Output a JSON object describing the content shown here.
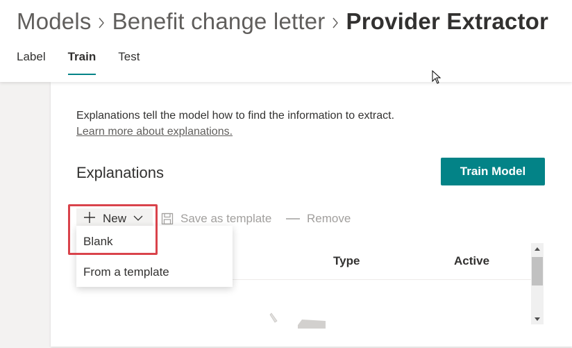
{
  "breadcrumb": {
    "items": [
      "Models",
      "Benefit change letter",
      "Provider Extractor"
    ]
  },
  "tabs": [
    {
      "label": "Label",
      "active": false
    },
    {
      "label": "Train",
      "active": true
    },
    {
      "label": "Test",
      "active": false
    }
  ],
  "card": {
    "description": "Explanations tell the model how to find the information to extract.",
    "learn_more": "Learn more about explanations.",
    "section_title": "Explanations",
    "train_button": "Train Model"
  },
  "toolbar": {
    "new_label": "New",
    "save_label": "Save as template",
    "remove_label": "Remove"
  },
  "table": {
    "columns": [
      "Type",
      "Active"
    ]
  },
  "new_menu": {
    "items": [
      "Blank",
      "From a template"
    ]
  },
  "colors": {
    "accent": "#038387",
    "highlight": "#d9434b"
  }
}
